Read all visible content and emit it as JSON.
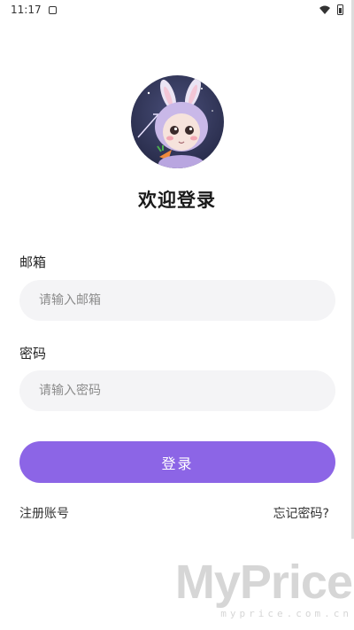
{
  "status_bar": {
    "time": "11:17"
  },
  "header": {
    "title": "欢迎登录"
  },
  "form": {
    "email_label": "邮箱",
    "email_placeholder": "请输入邮箱",
    "password_label": "密码",
    "password_placeholder": "请输入密码",
    "submit_label": "登录"
  },
  "links": {
    "register": "注册账号",
    "forgot": "忘记密码?"
  },
  "watermark": {
    "brand": "MyPrice",
    "url": "myprice.com.cn"
  },
  "icons": {
    "avatar": "bunny-avatar-icon",
    "wifi": "wifi-icon",
    "battery": "battery-icon",
    "notification": "notification-icon"
  },
  "colors": {
    "accent": "#8c65e6",
    "input_bg": "#f4f4f6"
  }
}
